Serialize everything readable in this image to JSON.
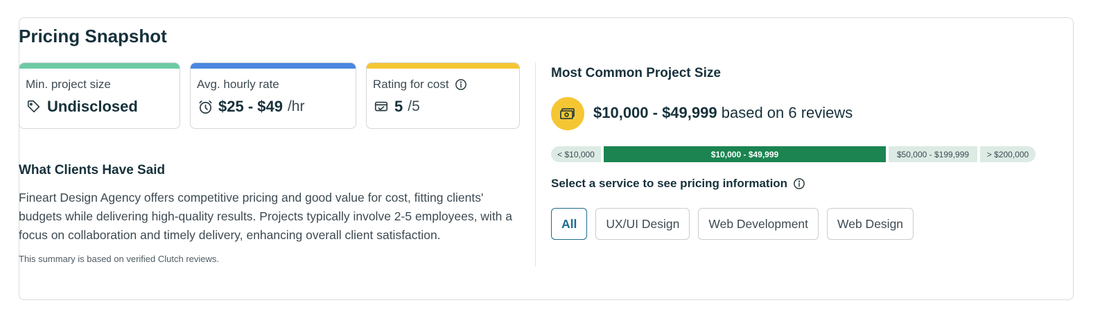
{
  "section_title": "Pricing Snapshot",
  "stats": [
    {
      "label": "Min. project size",
      "value": "Undisclosed",
      "unit": "",
      "icon": "tag-icon",
      "accent": "#6dcba4"
    },
    {
      "label": "Avg. hourly rate",
      "value": "$25 - $49",
      "unit": "/hr",
      "icon": "clock-icon",
      "accent": "#4a87e0"
    },
    {
      "label": "Rating for cost",
      "value": "5",
      "unit": "/5",
      "icon": "wallet-check-icon",
      "accent": "#f5c633",
      "has_info": true
    }
  ],
  "clients": {
    "title": "What Clients Have Said",
    "text": "Fineart Design Agency offers competitive pricing and good value for cost, fitting clients' budgets while delivering high-quality results. Projects typically involve 2-5 employees, with a focus on collaboration and timely delivery, enhancing overall client satisfaction.",
    "note": "This summary is based on verified Clutch reviews."
  },
  "common_project": {
    "title": "Most Common Project Size",
    "range": "$10,000 - $49,999",
    "suffix": "based on 6 reviews",
    "icon": "money-icon",
    "segments": [
      {
        "label": "< $10,000",
        "active": false
      },
      {
        "label": "$10,000 - $49,999",
        "active": true
      },
      {
        "label": "$50,000 - $199,999",
        "active": false
      },
      {
        "label": "> $200,000",
        "active": false
      }
    ]
  },
  "services": {
    "title": "Select a service to see pricing information",
    "items": [
      {
        "label": "All",
        "active": true
      },
      {
        "label": "UX/UI Design",
        "active": false
      },
      {
        "label": "Web Development",
        "active": false
      },
      {
        "label": "Web Design",
        "active": false
      }
    ]
  },
  "colors": {
    "dark_text": "#17313b",
    "active_segment": "#1b8451",
    "inactive_segment": "#dcebe4",
    "active_service": "#1d6c8c"
  }
}
